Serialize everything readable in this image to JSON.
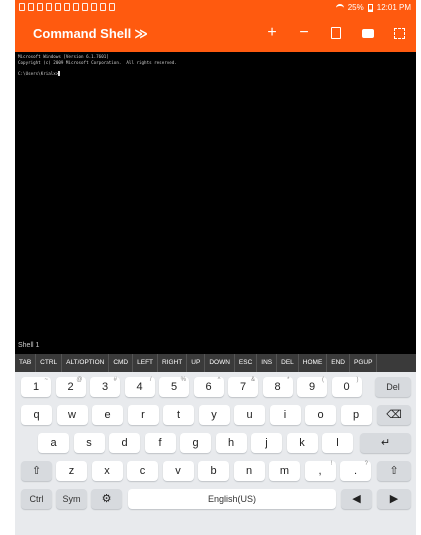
{
  "status": {
    "battery": "25%",
    "time": "12:01 PM"
  },
  "app": {
    "title": "Command Shell",
    "title_chevron": "≫"
  },
  "terminal": {
    "lines": [
      "Microsoft Windows [Version 6.1.7601]",
      "Copyright (c) 2009 Microsoft Corporation.  All rights reserved.",
      "",
      "C:\\Users\\Krialx>"
    ]
  },
  "shell_tab": "Shell 1",
  "extra_keys": [
    "TAB",
    "CTRL",
    "ALT/OPTION",
    "CMD",
    "LEFT",
    "RIGHT",
    "UP",
    "DOWN",
    "ESC",
    "INS",
    "DEL",
    "HOME",
    "END",
    "PGUP"
  ],
  "keyboard": {
    "numbers": [
      {
        "k": "1",
        "s": "~"
      },
      {
        "k": "2",
        "s": "@"
      },
      {
        "k": "3",
        "s": "#"
      },
      {
        "k": "4",
        "s": "/"
      },
      {
        "k": "5",
        "s": "%"
      },
      {
        "k": "6",
        "s": "^"
      },
      {
        "k": "7",
        "s": "&"
      },
      {
        "k": "8",
        "s": "*"
      },
      {
        "k": "9",
        "s": "("
      },
      {
        "k": "0",
        "s": ")"
      }
    ],
    "del": "Del",
    "row1": [
      "q",
      "w",
      "e",
      "r",
      "t",
      "y",
      "u",
      "i",
      "o",
      "p"
    ],
    "row2": [
      "a",
      "s",
      "d",
      "f",
      "g",
      "h",
      "j",
      "k",
      "l"
    ],
    "row3": [
      "z",
      "x",
      "c",
      "v",
      "b",
      "n",
      "m",
      ",",
      "."
    ],
    "row3_subs": {
      "comma": "!",
      "period": "?"
    },
    "ctrl": "Ctrl",
    "sym": "Sym",
    "space": "English(US)"
  }
}
